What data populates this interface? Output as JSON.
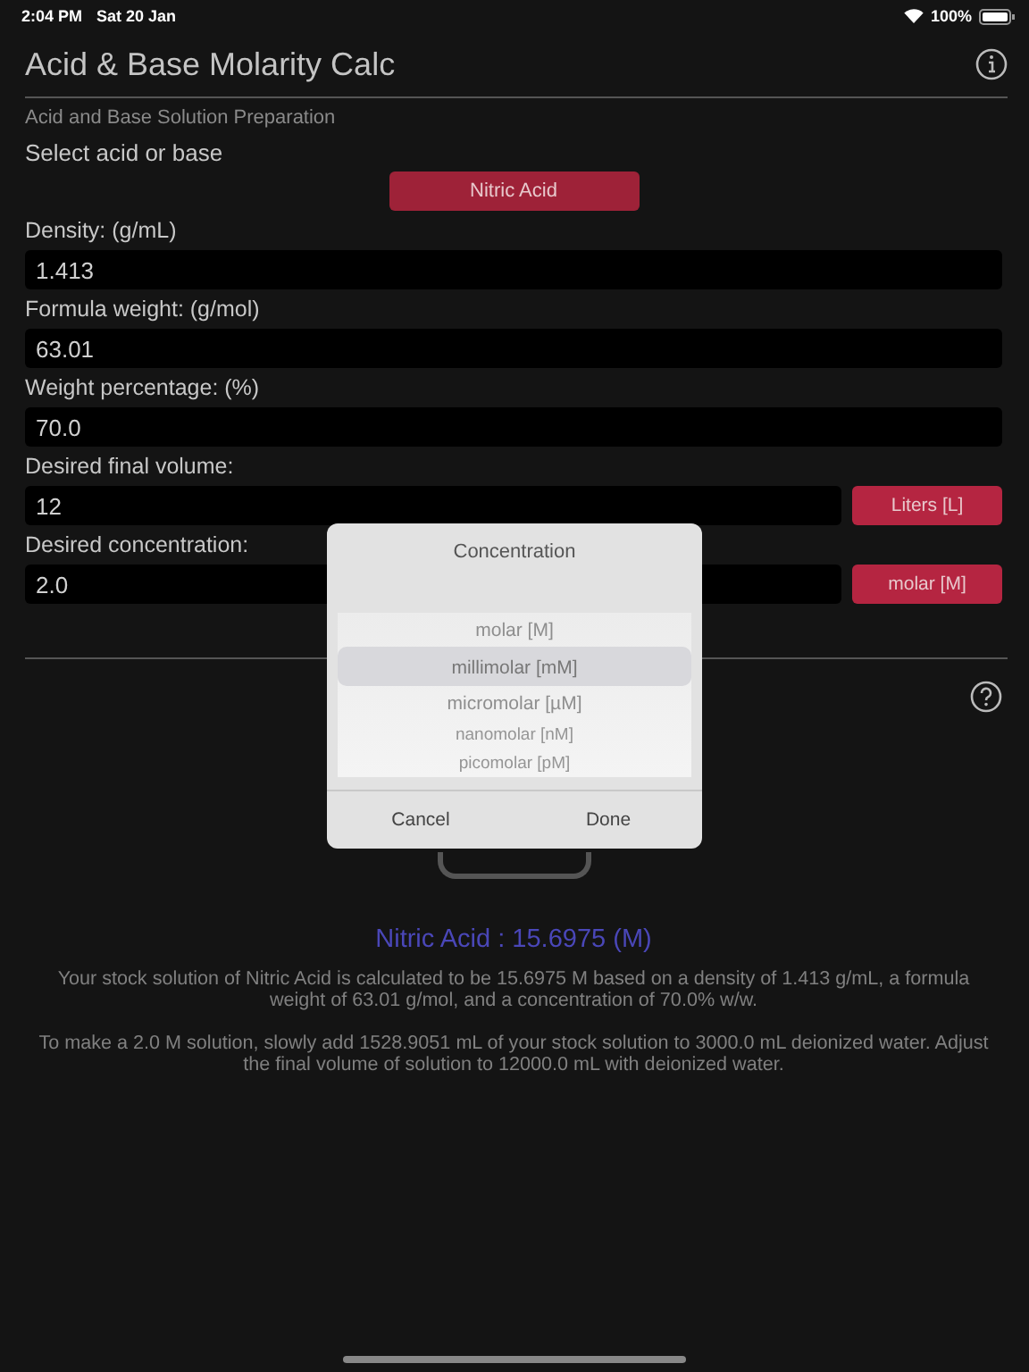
{
  "status_bar": {
    "time": "2:04 PM",
    "date": "Sat 20 Jan",
    "battery": "100%"
  },
  "nav": {
    "title": "Acid & Base Molarity Calc"
  },
  "section_title": "Acid and Base Solution Preparation",
  "select_label": "Select acid or base",
  "selected_compound": "Nitric Acid",
  "fields": [
    {
      "label": "Density:  (g/mL)",
      "value": "1.413"
    },
    {
      "label": "Formula weight:  (g/mol)",
      "value": "63.01"
    },
    {
      "label": "Weight percentage:  (%)",
      "value": "70.0"
    },
    {
      "label": "Desired final volume:",
      "value": "12",
      "unit": "Liters [L]"
    },
    {
      "label": "Desired concentration:",
      "value": "2.0",
      "unit": "molar [M]"
    }
  ],
  "result": {
    "title": "Nitric Acid : 15.6975 (M)",
    "paragraphs": [
      "Your stock solution of Nitric Acid is calculated to be 15.6975 M based on a density of 1.413 g/mL, a formula weight of 63.01 g/mol, and a concentration of 70.0% w/w.",
      "To make a 2.0 M solution, slowly add 1528.9051 mL of your stock solution to 3000.0 mL deionized water. Adjust the final volume of solution to 12000.0 mL with deionized water."
    ]
  },
  "picker_dialog": {
    "title": "Concentration",
    "options": [
      {
        "label": "molar [M]",
        "selected": false
      },
      {
        "label": "millimolar [mM]",
        "selected": true
      },
      {
        "label": "micromolar [µM]",
        "selected": false
      },
      {
        "label": "nanomolar [nM]",
        "selected": false
      },
      {
        "label": "picomolar [pM]",
        "selected": false
      }
    ],
    "buttons": [
      "Cancel",
      "Done"
    ]
  }
}
